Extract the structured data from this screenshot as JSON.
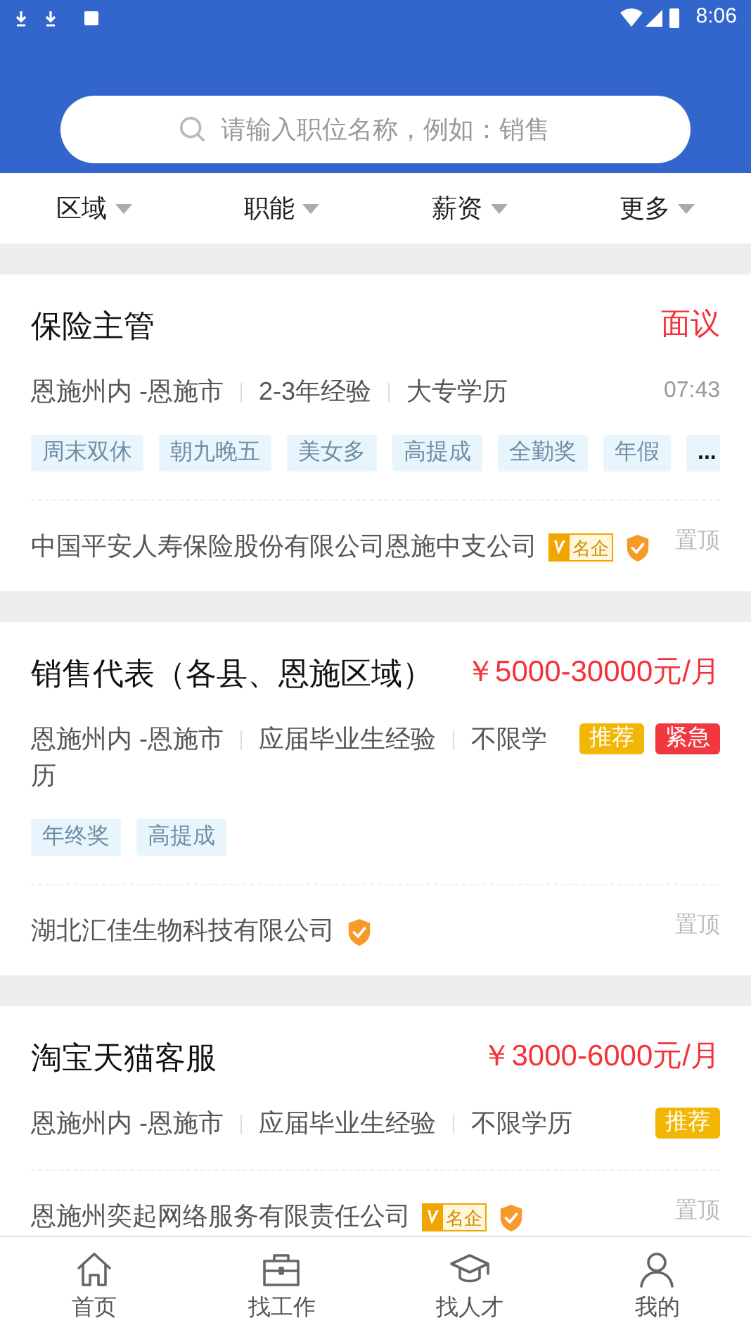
{
  "status_bar": {
    "time": "8:06"
  },
  "search": {
    "placeholder": "请输入职位名称，例如：销售"
  },
  "filters": [
    {
      "label": "区域"
    },
    {
      "label": "职能"
    },
    {
      "label": "薪资"
    },
    {
      "label": "更多"
    }
  ],
  "jobs": [
    {
      "title": "保险主管",
      "salary": "面议",
      "location": "恩施州内 -恩施市",
      "experience": "2-3年经验",
      "education": "大专学历",
      "time": "07:43",
      "tags": [
        "周末双休",
        "朝九晚五",
        "美女多",
        "高提成",
        "全勤奖",
        "年假"
      ],
      "more_tags": "...",
      "company": "中国平安人寿保险股份有限公司恩施中支公司",
      "famous": "名企",
      "verified": true,
      "pin": "置顶"
    },
    {
      "title": "销售代表（各县、恩施区域）",
      "salary": "￥5000-30000元/月",
      "location": "恩施州内 -恩施市",
      "experience": "应届毕业生经验",
      "education": "不限学历",
      "badges": [
        {
          "label": "推荐",
          "color": "#f2b705"
        },
        {
          "label": "紧急",
          "color": "#f0383e"
        }
      ],
      "tags": [
        "年终奖",
        "高提成"
      ],
      "company": "湖北汇佳生物科技有限公司",
      "verified": true,
      "pin": "置顶"
    },
    {
      "title": "淘宝天猫客服",
      "salary": "￥3000-6000元/月",
      "location": "恩施州内 -恩施市",
      "experience": "应届毕业生经验",
      "education": "不限学历",
      "badges": [
        {
          "label": "推荐",
          "color": "#f2b705"
        }
      ],
      "company": "恩施州奕起网络服务有限责任公司",
      "famous": "名企",
      "verified": true,
      "pin": "置顶"
    }
  ],
  "nav": [
    {
      "label": "首页"
    },
    {
      "label": "找工作"
    },
    {
      "label": "找人才"
    },
    {
      "label": "我的"
    }
  ]
}
